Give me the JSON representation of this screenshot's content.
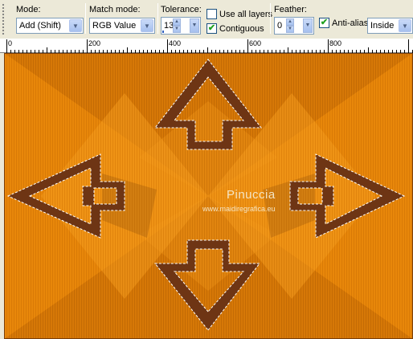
{
  "toolbar": {
    "mode": {
      "label": "Mode:",
      "value": "Add (Shift)"
    },
    "match_mode": {
      "label": "Match mode:",
      "value": "RGB Value"
    },
    "tolerance": {
      "label": "Tolerance:",
      "value": "13"
    },
    "use_all_layers": {
      "label": "Use all layers",
      "checked": false
    },
    "contiguous": {
      "label": "Contiguous",
      "checked": true
    },
    "feather": {
      "label": "Feather:",
      "value": "0"
    },
    "anti_alias": {
      "label": "Anti-alias",
      "checked": true
    },
    "anti_alias_mode": {
      "value": "Inside"
    }
  },
  "ruler": {
    "marks": [
      "0",
      "200",
      "400",
      "600",
      "800"
    ]
  },
  "canvas": {
    "watermark_title": "Pinuccia",
    "watermark_url": "www.maidiregrafica.eu",
    "colors": {
      "orange": "#e8870a",
      "light_orange": "#f59c1e",
      "dark_orange": "#c66a05",
      "brown": "#6e3514"
    }
  },
  "icons": {
    "dropdown": "chevron-down-icon",
    "spin": "spin-arrows-icon",
    "check": "check-icon"
  }
}
